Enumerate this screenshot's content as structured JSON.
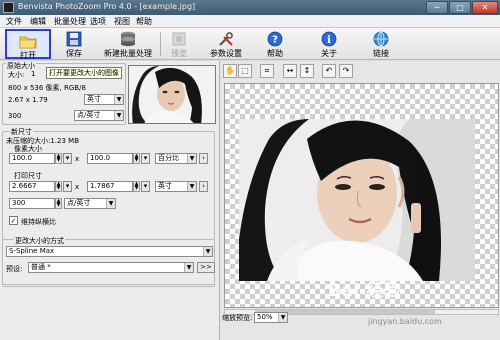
{
  "window": {
    "title": "Benvista PhotoZoom Pro 4.0 - [example.jpg]",
    "min": "─",
    "max": "□",
    "close": "✕"
  },
  "menu": [
    "文件",
    "编辑",
    "批量处理",
    "选项",
    "视图",
    "帮助"
  ],
  "toolbar": {
    "open": "打开",
    "save": "保存",
    "new_batch": "新建批量处理",
    "preview": "预览",
    "settings": "参数设置",
    "help": "帮助",
    "about": "关于",
    "link": "链接"
  },
  "original": {
    "group": "原始大小",
    "size_label": "大小:",
    "size_value": "1",
    "tooltip": "打开要更改大小的图像",
    "pixels": "800 x 536 像素, RGB/8",
    "dims": "2.67 x 1.79",
    "dims_unit": "英寸",
    "res": "300",
    "res_unit": "点/英寸"
  },
  "new_size": {
    "group": "新尺寸",
    "uncompressed": "未压缩的大小:1.23 MB",
    "pixel_group": "像素大小",
    "px_w": "100.0",
    "px_x": "x",
    "px_h": "100.0",
    "px_unit": "百分比",
    "print_group": "打印尺寸",
    "pr_w": "2.6667",
    "pr_x": "x",
    "pr_h": "1.7867",
    "pr_unit": "英寸",
    "pr_res": "300",
    "pr_res_unit": "点/英寸",
    "keep_ratio": "维持纵横比"
  },
  "method": {
    "group": "更改大小的方式",
    "algorithm": "S-Spline Max",
    "preset_label": "预设:",
    "preset_value": "普通 *",
    "more": ">>"
  },
  "view": {
    "zoom_label": "缩放预览:",
    "zoom_value": "50%",
    "hand": "✋",
    "select": "⬚",
    "crop": "⌗",
    "fit_w": "↔",
    "fit_h": "↕",
    "undo": "↶",
    "redo": "↷"
  },
  "watermark": {
    "main": "Bai 经验",
    "sub": "jingyan.baidu.com"
  },
  "colors": {
    "accent": "#2f3cd8",
    "titlebar": "#4a667c"
  }
}
